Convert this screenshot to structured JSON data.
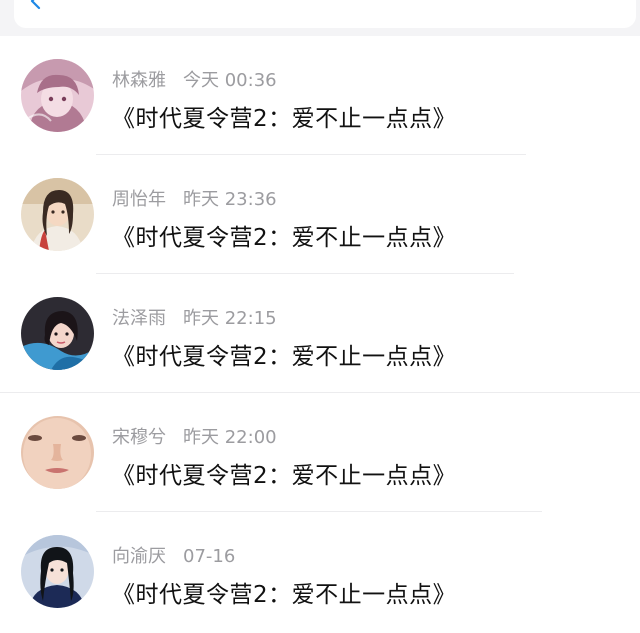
{
  "header": {
    "back_icon": "chevron-left-icon",
    "accent": "#1e88e5"
  },
  "comments": [
    {
      "name": "林森雅",
      "time": "今天 00:36",
      "text": "《时代夏令营2：爱不止一点点》"
    },
    {
      "name": "周怡年",
      "time": "昨天 23:36",
      "text": "《时代夏令营2：爱不止一点点》"
    },
    {
      "name": "法泽雨",
      "time": "昨天 22:15",
      "text": "《时代夏令营2：爱不止一点点》"
    },
    {
      "name": "宋穆兮",
      "time": "昨天 22:00",
      "text": "《时代夏令营2：爱不止一点点》"
    },
    {
      "name": "向渝厌",
      "time": "07-16",
      "text": "《时代夏令营2：爱不止一点点》"
    }
  ]
}
